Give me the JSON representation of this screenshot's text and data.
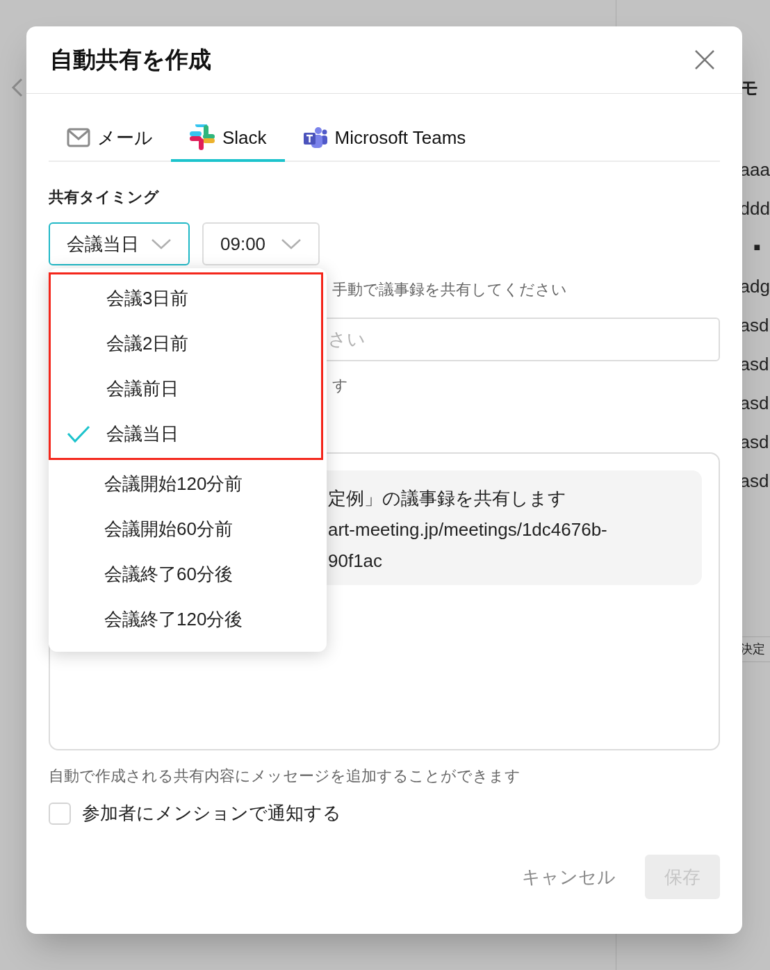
{
  "side_panel": {
    "heading": "モ",
    "lines": [
      {
        "kind": "text",
        "text": "aaa"
      },
      {
        "kind": "text",
        "text": "ddd"
      },
      {
        "kind": "bullet",
        "text": "■"
      },
      {
        "kind": "text",
        "text": "adg"
      },
      {
        "kind": "text",
        "text": "asd"
      },
      {
        "kind": "text",
        "text": "asd"
      },
      {
        "kind": "text",
        "text": "asd"
      },
      {
        "kind": "text",
        "text": "asd"
      },
      {
        "kind": "text",
        "text": "asd"
      }
    ],
    "footer": "決定"
  },
  "modal": {
    "title": "自動共有を作成",
    "tabs": [
      {
        "label": "メール",
        "kind": "mail",
        "selected": false
      },
      {
        "label": "Slack",
        "kind": "slack",
        "selected": true
      },
      {
        "label": "Microsoft Teams",
        "kind": "teams",
        "selected": false
      }
    ],
    "timing": {
      "label": "共有タイミング",
      "day_select": {
        "value": "会議当日",
        "focused": true
      },
      "time_select": {
        "value": "09:00",
        "focused": false
      }
    },
    "helper_text": "手動で議事録を共有してください",
    "channel_field": {
      "placeholder": "さい"
    },
    "note": "す",
    "message": {
      "lines": [
        "定例」の議事録を共有します",
        "art-meeting.jp/meetings/1dc4676b-",
        "90f1ac"
      ]
    },
    "message_hint": "自動で作成される共有内容にメッセージを追加することができます",
    "mention": {
      "label": "参加者にメンションで通知する",
      "checked": false
    },
    "buttons": {
      "cancel": "キャンセル",
      "save": {
        "label": "保存",
        "disabled": true
      }
    },
    "dropdown": {
      "options": [
        {
          "label": "会議3日前",
          "selected": false,
          "highlighted": true
        },
        {
          "label": "会議2日前",
          "selected": false,
          "highlighted": true
        },
        {
          "label": "会議前日",
          "selected": false,
          "highlighted": true
        },
        {
          "label": "会議当日",
          "selected": true,
          "highlighted": true
        },
        {
          "label": "会議開始120分前",
          "selected": false,
          "highlighted": false
        },
        {
          "label": "会議開始60分前",
          "selected": false,
          "highlighted": false
        },
        {
          "label": "会議終了60分後",
          "selected": false,
          "highlighted": false
        },
        {
          "label": "会議終了120分後",
          "selected": false,
          "highlighted": false
        }
      ]
    }
  }
}
